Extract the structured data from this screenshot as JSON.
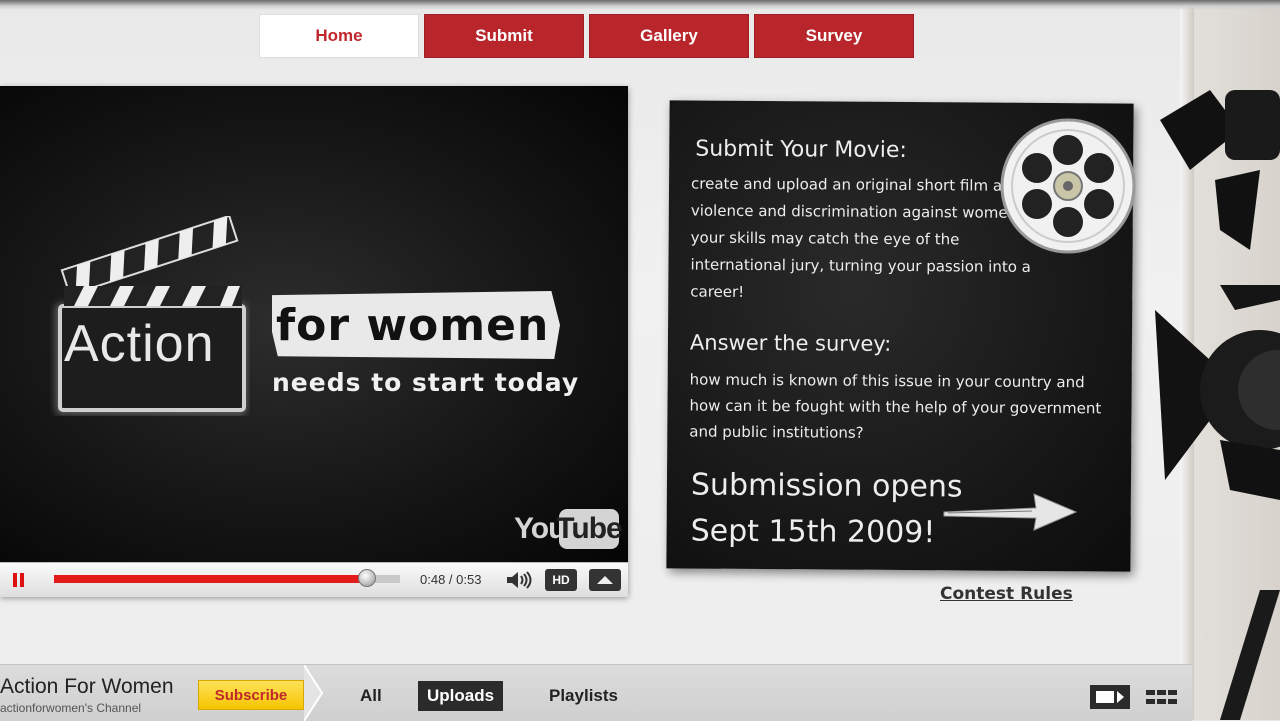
{
  "nav": {
    "tabs": [
      {
        "label": "Home",
        "active": true
      },
      {
        "label": "Submit",
        "active": false
      },
      {
        "label": "Gallery",
        "active": false
      },
      {
        "label": "Survey",
        "active": false
      }
    ]
  },
  "video": {
    "title_word": "Action",
    "headline": "for women",
    "tagline": "needs to start today",
    "watermark_you": "You",
    "watermark_tube": "Tube",
    "time": "0:48 / 0:53",
    "progress": 0.9057,
    "hd_label": "HD",
    "play_state": "pause-icon"
  },
  "board": {
    "heading1": "Submit Your Movie:",
    "body1": "create and upload an original short film about violence and discrimination against women and your skills may catch the eye of the international jury, turning your passion into a career!",
    "heading2": "Answer the survey:",
    "body2": "how much is known of this issue in your country and how can it be fought with the help of your government and public institutions?",
    "announce_line1": "Submission opens",
    "announce_line2": "Sept 15th 2009!",
    "contest_rules": "Contest Rules"
  },
  "channel": {
    "title": "Action For Women",
    "subtitle": "actionforwomen's Channel",
    "subscribe": "Subscribe",
    "tabs": [
      "All",
      "Uploads",
      "Playlists"
    ],
    "active_tab": "Uploads"
  },
  "colors": {
    "nav_red": "#b8262b",
    "progress_red": "#e31b1b",
    "subscribe_yellow": "#f5c400"
  }
}
